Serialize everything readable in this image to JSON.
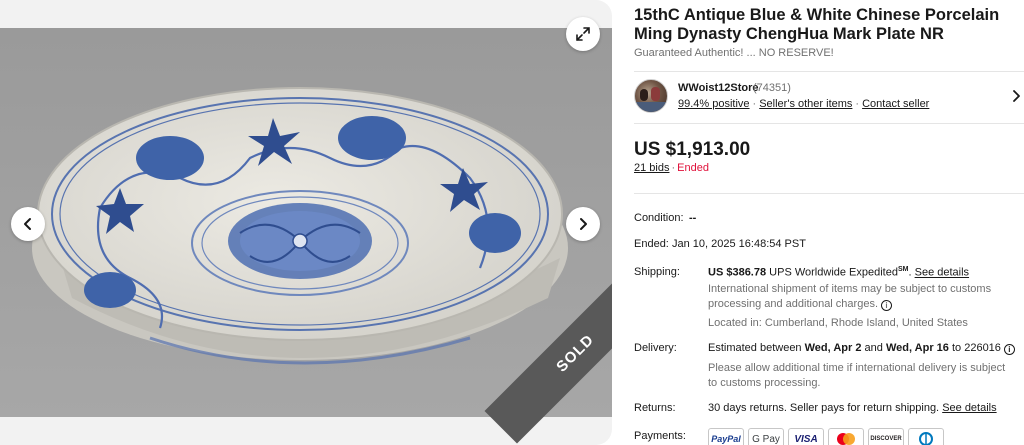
{
  "listing": {
    "title": "15thC Antique Blue & White Chinese Porcelain Ming Dynasty ChengHua Mark Plate NR",
    "subtitle": "Guaranteed Authentic! ... NO RESERVE!"
  },
  "gallery": {
    "sold_label": "SOLD",
    "icons": {
      "expand": "expand-icon",
      "prev": "chevron-left-icon",
      "next": "chevron-right-icon"
    }
  },
  "seller": {
    "name": "WWoist12Store",
    "feedback_count": "(74351)",
    "positive": "99.4% positive",
    "other_items": "Seller's other items",
    "contact": "Contact seller",
    "separator": "·"
  },
  "price": {
    "amount": "US $1,913.00",
    "bids": "21 bids",
    "separator": "·",
    "status": "Ended"
  },
  "details": {
    "condition_label": "Condition:",
    "condition_value": "--",
    "ended_label": "Ended:",
    "ended_value": "Jan 10, 2025 16:48:54 PST",
    "shipping_label": "Shipping:",
    "shipping_cost": "US $386.78",
    "shipping_service": "UPS Worldwide Expedited",
    "shipping_sup": "SM",
    "shipping_period": ".",
    "shipping_details_link": "See details",
    "shipping_note": "International shipment of items may be subject to customs processing and additional charges.",
    "located": "Located in: Cumberland, Rhode Island, United States",
    "delivery_label": "Delivery:",
    "delivery_prefix": "Estimated between",
    "delivery_start": "Wed, Apr 2",
    "delivery_and": "and",
    "delivery_end": "Wed, Apr 16",
    "delivery_to": "to 226016",
    "delivery_note": "Please allow additional time if international delivery is subject to customs processing.",
    "returns_label": "Returns:",
    "returns_value": "30 days returns. Seller pays for return shipping.",
    "returns_link": "See details",
    "payments_label": "Payments:"
  },
  "payments": [
    "PayPal",
    "G Pay",
    "VISA",
    "",
    "DISCOVER",
    ""
  ],
  "colors": {
    "ended": "#e0103a",
    "ribbon": "#595959",
    "porcelain_blue": "#3f63a8"
  }
}
